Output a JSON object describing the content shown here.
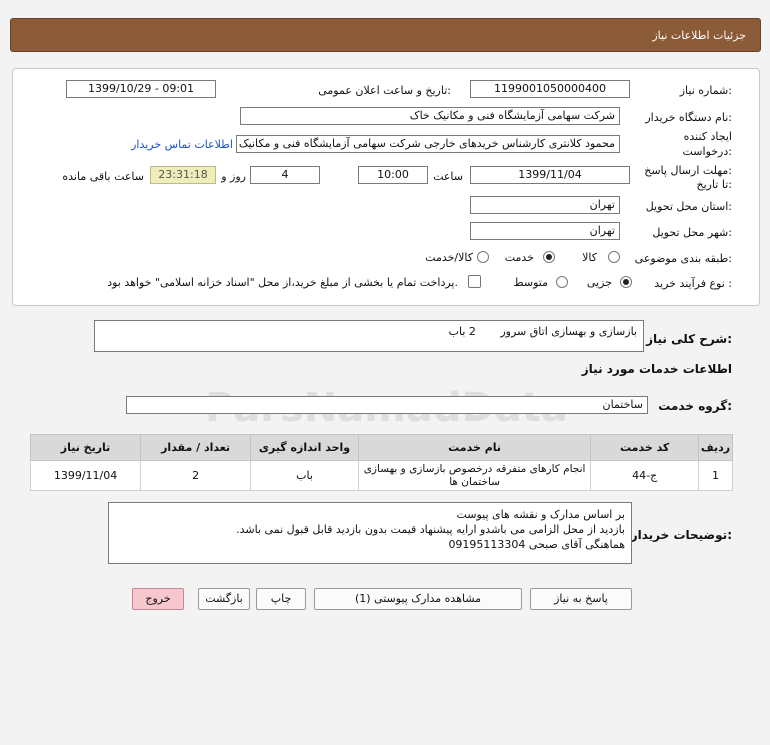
{
  "header": {
    "title": "جزئیات اطلاعات نیاز"
  },
  "form": {
    "need_number_label": "شماره نیاز:",
    "need_number": "1199001050000400",
    "announce_label": "تاریخ و ساعت اعلان عمومی:",
    "announce_value": "1399/10/29 - 09:01",
    "buyer_org_label": "نام دستگاه خریدار:",
    "buyer_org": "شرکت سهامی آزمایشگاه فنی و مکانیک خاک",
    "creator_label_1": "ایجاد کننده",
    "creator_label_2": "درخواست:",
    "creator": "محمود کلانتری کارشناس خریدهای خارجی  شرکت سهامی آزمایشگاه فنی و مکانیک خاک",
    "contact_link": "اطلاعات تماس خریدار",
    "deadline_label_1": "مهلت ارسال پاسخ:",
    "deadline_label_2": "تا تاریخ:",
    "deadline_date": "1399/11/04",
    "time_label": "ساعت",
    "deadline_time": "10:00",
    "days_value": "4",
    "days_label": "روز و",
    "remaining_time": "23:31:18",
    "remaining_label": "ساعت باقی مانده",
    "province_label": "استان محل تحویل:",
    "province": "تهران",
    "city_label": "شهر محل تحویل:",
    "city": "تهران",
    "category_label": "طبقه بندی موضوعی:",
    "category_options": [
      "کالا",
      "خدمت",
      "کالا/خدمت"
    ],
    "process_label": "نوع فرآیند خرید :",
    "process_options": [
      "جزیی",
      "متوسط"
    ],
    "payment_note": "پرداخت تمام یا بخشی از مبلغ خرید،از محل \"اسناد خزانه اسلامی\" خواهد بود."
  },
  "summary": {
    "label": "شرح کلی نیاز:",
    "text": "بازسازی و بهسازی اتاق سرور       2 باب"
  },
  "services": {
    "section_title": "اطلاعات خدمات مورد نیاز",
    "group_label": "گروه خدمت:",
    "group_value": "ساختمان",
    "columns": [
      "ردیف",
      "کد خدمت",
      "نام خدمت",
      "واحد اندازه گیری",
      "تعداد / مقدار",
      "تاریخ نیاز"
    ],
    "rows": [
      {
        "row": "1",
        "code": "ج-44",
        "name": "انجام کارهای متفرقه درخصوص بازسازی و بهسازی ساختمان ها",
        "unit": "باب",
        "qty": "2",
        "date": "1399/11/04"
      }
    ]
  },
  "buyer_notes": {
    "label": "توضیحات خریدار:",
    "lines": [
      "بر اساس مدارک و نقشه های پیوست",
      "بازدید از محل الزامی می باشدو ارایه پیشنهاد قیمت بدون بازدید قابل قبول نمی باشد.",
      "هماهنگی آقای صبحی 09195113304"
    ]
  },
  "buttons": {
    "reply": "پاسخ به نیاز",
    "attachments": "مشاهده مدارک پیوستی (1)",
    "print": "چاپ",
    "back": "بازگشت",
    "exit": "خروج"
  }
}
